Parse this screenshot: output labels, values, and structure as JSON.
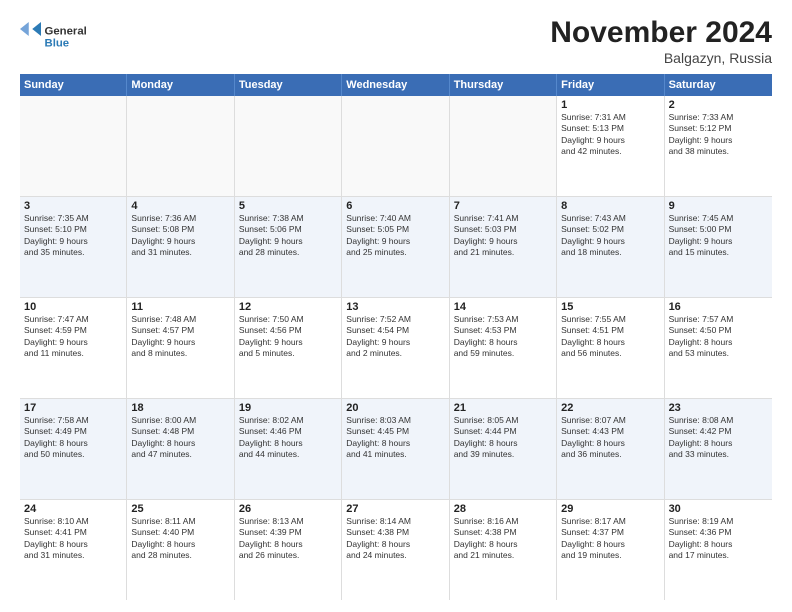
{
  "logo": {
    "general": "General",
    "blue": "Blue"
  },
  "title": "November 2024",
  "location": "Balgazyn, Russia",
  "days_of_week": [
    "Sunday",
    "Monday",
    "Tuesday",
    "Wednesday",
    "Thursday",
    "Friday",
    "Saturday"
  ],
  "weeks": [
    [
      {
        "day": "",
        "info": ""
      },
      {
        "day": "",
        "info": ""
      },
      {
        "day": "",
        "info": ""
      },
      {
        "day": "",
        "info": ""
      },
      {
        "day": "",
        "info": ""
      },
      {
        "day": "1",
        "info": "Sunrise: 7:31 AM\nSunset: 5:13 PM\nDaylight: 9 hours\nand 42 minutes."
      },
      {
        "day": "2",
        "info": "Sunrise: 7:33 AM\nSunset: 5:12 PM\nDaylight: 9 hours\nand 38 minutes."
      }
    ],
    [
      {
        "day": "3",
        "info": "Sunrise: 7:35 AM\nSunset: 5:10 PM\nDaylight: 9 hours\nand 35 minutes."
      },
      {
        "day": "4",
        "info": "Sunrise: 7:36 AM\nSunset: 5:08 PM\nDaylight: 9 hours\nand 31 minutes."
      },
      {
        "day": "5",
        "info": "Sunrise: 7:38 AM\nSunset: 5:06 PM\nDaylight: 9 hours\nand 28 minutes."
      },
      {
        "day": "6",
        "info": "Sunrise: 7:40 AM\nSunset: 5:05 PM\nDaylight: 9 hours\nand 25 minutes."
      },
      {
        "day": "7",
        "info": "Sunrise: 7:41 AM\nSunset: 5:03 PM\nDaylight: 9 hours\nand 21 minutes."
      },
      {
        "day": "8",
        "info": "Sunrise: 7:43 AM\nSunset: 5:02 PM\nDaylight: 9 hours\nand 18 minutes."
      },
      {
        "day": "9",
        "info": "Sunrise: 7:45 AM\nSunset: 5:00 PM\nDaylight: 9 hours\nand 15 minutes."
      }
    ],
    [
      {
        "day": "10",
        "info": "Sunrise: 7:47 AM\nSunset: 4:59 PM\nDaylight: 9 hours\nand 11 minutes."
      },
      {
        "day": "11",
        "info": "Sunrise: 7:48 AM\nSunset: 4:57 PM\nDaylight: 9 hours\nand 8 minutes."
      },
      {
        "day": "12",
        "info": "Sunrise: 7:50 AM\nSunset: 4:56 PM\nDaylight: 9 hours\nand 5 minutes."
      },
      {
        "day": "13",
        "info": "Sunrise: 7:52 AM\nSunset: 4:54 PM\nDaylight: 9 hours\nand 2 minutes."
      },
      {
        "day": "14",
        "info": "Sunrise: 7:53 AM\nSunset: 4:53 PM\nDaylight: 8 hours\nand 59 minutes."
      },
      {
        "day": "15",
        "info": "Sunrise: 7:55 AM\nSunset: 4:51 PM\nDaylight: 8 hours\nand 56 minutes."
      },
      {
        "day": "16",
        "info": "Sunrise: 7:57 AM\nSunset: 4:50 PM\nDaylight: 8 hours\nand 53 minutes."
      }
    ],
    [
      {
        "day": "17",
        "info": "Sunrise: 7:58 AM\nSunset: 4:49 PM\nDaylight: 8 hours\nand 50 minutes."
      },
      {
        "day": "18",
        "info": "Sunrise: 8:00 AM\nSunset: 4:48 PM\nDaylight: 8 hours\nand 47 minutes."
      },
      {
        "day": "19",
        "info": "Sunrise: 8:02 AM\nSunset: 4:46 PM\nDaylight: 8 hours\nand 44 minutes."
      },
      {
        "day": "20",
        "info": "Sunrise: 8:03 AM\nSunset: 4:45 PM\nDaylight: 8 hours\nand 41 minutes."
      },
      {
        "day": "21",
        "info": "Sunrise: 8:05 AM\nSunset: 4:44 PM\nDaylight: 8 hours\nand 39 minutes."
      },
      {
        "day": "22",
        "info": "Sunrise: 8:07 AM\nSunset: 4:43 PM\nDaylight: 8 hours\nand 36 minutes."
      },
      {
        "day": "23",
        "info": "Sunrise: 8:08 AM\nSunset: 4:42 PM\nDaylight: 8 hours\nand 33 minutes."
      }
    ],
    [
      {
        "day": "24",
        "info": "Sunrise: 8:10 AM\nSunset: 4:41 PM\nDaylight: 8 hours\nand 31 minutes."
      },
      {
        "day": "25",
        "info": "Sunrise: 8:11 AM\nSunset: 4:40 PM\nDaylight: 8 hours\nand 28 minutes."
      },
      {
        "day": "26",
        "info": "Sunrise: 8:13 AM\nSunset: 4:39 PM\nDaylight: 8 hours\nand 26 minutes."
      },
      {
        "day": "27",
        "info": "Sunrise: 8:14 AM\nSunset: 4:38 PM\nDaylight: 8 hours\nand 24 minutes."
      },
      {
        "day": "28",
        "info": "Sunrise: 8:16 AM\nSunset: 4:38 PM\nDaylight: 8 hours\nand 21 minutes."
      },
      {
        "day": "29",
        "info": "Sunrise: 8:17 AM\nSunset: 4:37 PM\nDaylight: 8 hours\nand 19 minutes."
      },
      {
        "day": "30",
        "info": "Sunrise: 8:19 AM\nSunset: 4:36 PM\nDaylight: 8 hours\nand 17 minutes."
      }
    ]
  ]
}
